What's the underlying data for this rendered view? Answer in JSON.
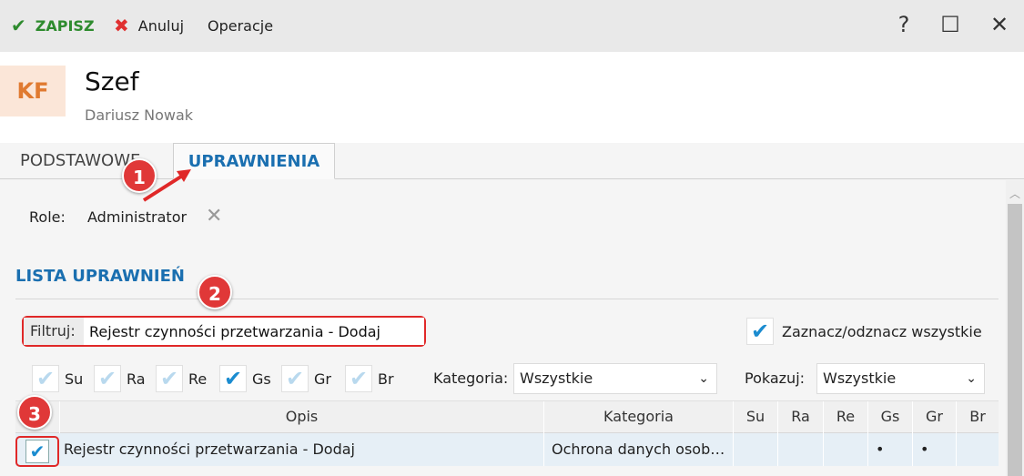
{
  "toolbar": {
    "save_label": "ZAPISZ",
    "cancel_label": "Anuluj",
    "operations_label": "Operacje"
  },
  "window": {
    "help_glyph": "?",
    "maximize_glyph": "☐",
    "close_glyph": "✕"
  },
  "header": {
    "avatar_initials": "KF",
    "title": "Szef",
    "subtitle": "Dariusz Nowak"
  },
  "tabs": [
    {
      "label": "PODSTAWOWE"
    },
    {
      "label": "UPRAWNIENIA",
      "active": true
    }
  ],
  "role": {
    "label": "Role:",
    "value": "Administrator"
  },
  "section": {
    "title": "LISTA UPRAWNIEŃ"
  },
  "filter": {
    "label": "Filtruj:",
    "value": "Rejestr czynności przetwarzania - Dodaj"
  },
  "check_all": {
    "label": "Zaznacz/odznacz wszystkie",
    "checked": true
  },
  "levels": [
    {
      "label": "Su",
      "checked": false
    },
    {
      "label": "Ra",
      "checked": false
    },
    {
      "label": "Re",
      "checked": false
    },
    {
      "label": "Gs",
      "checked": true
    },
    {
      "label": "Gr",
      "checked": false
    },
    {
      "label": "Br",
      "checked": false
    }
  ],
  "category_filter": {
    "label": "Kategoria:",
    "value": "Wszystkie"
  },
  "show_filter": {
    "label": "Pokazuj:",
    "value": "Wszystkie"
  },
  "table": {
    "columns": [
      "Opis",
      "Kategoria",
      "Su",
      "Ra",
      "Re",
      "Gs",
      "Gr",
      "Br"
    ],
    "rows": [
      {
        "checked": true,
        "opis": "Rejestr czynności przetwarzania - Dodaj",
        "kategoria": "Ochrona danych osob…",
        "su": "",
        "ra": "",
        "re": "",
        "gs": "•",
        "gr": "•",
        "br": ""
      }
    ]
  },
  "annotations": [
    "1",
    "2",
    "3"
  ],
  "colors": {
    "accent": "#1a6fb0",
    "save": "#2e8b2e",
    "cancel": "#e03030",
    "badge": "#e03838",
    "check": "#1b8cd0"
  }
}
